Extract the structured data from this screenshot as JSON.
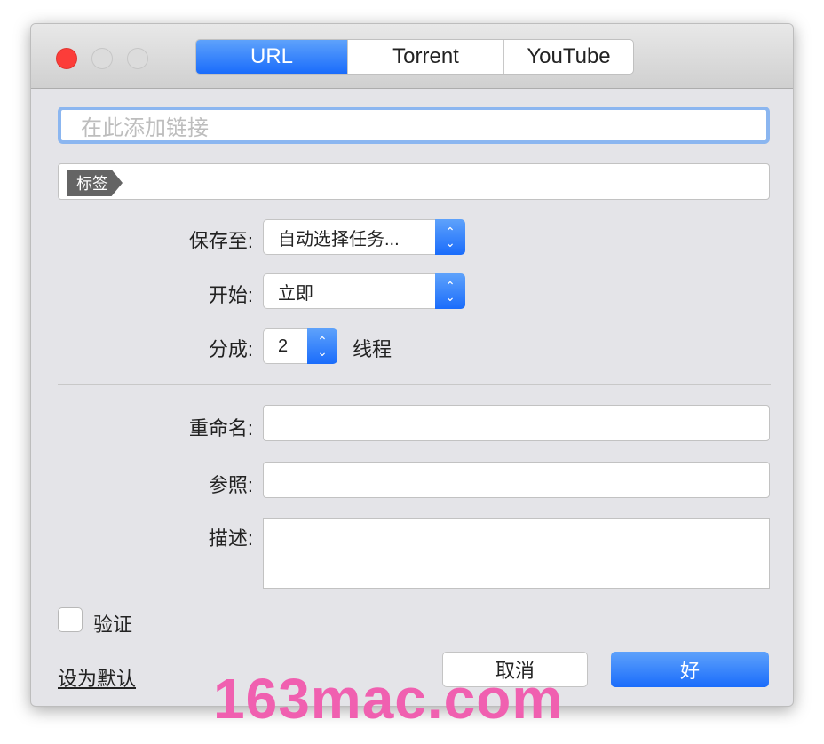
{
  "tabs": [
    {
      "label": "URL",
      "active": true
    },
    {
      "label": "Torrent",
      "active": false
    },
    {
      "label": "YouTube",
      "active": false
    }
  ],
  "url_input": {
    "placeholder": "在此添加链接",
    "value": ""
  },
  "tag_label": "标签",
  "save_to": {
    "label": "保存至:",
    "value": "自动选择任务..."
  },
  "start": {
    "label": "开始:",
    "value": "立即"
  },
  "split": {
    "label": "分成:",
    "value": "2",
    "suffix": "线程"
  },
  "rename": {
    "label": "重命名:",
    "value": ""
  },
  "referer": {
    "label": "参照:",
    "value": ""
  },
  "description": {
    "label": "描述:",
    "value": ""
  },
  "verify": {
    "label": "验证",
    "checked": false
  },
  "set_default": "设为默认",
  "cancel": "取消",
  "ok": "好",
  "watermark": "163mac.com",
  "colors": {
    "accent": "#1a6cfb",
    "close": "#fc3d39"
  }
}
